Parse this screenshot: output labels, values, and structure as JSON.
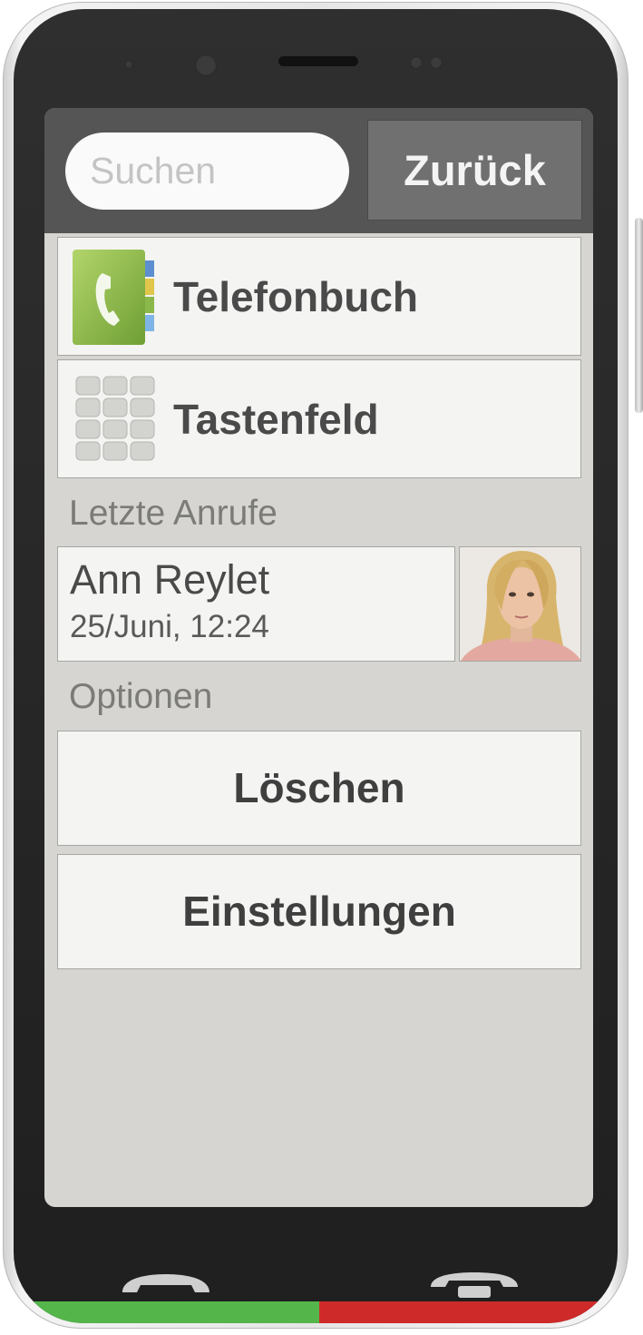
{
  "header": {
    "search_placeholder": "Suchen",
    "back_label": "Zurück"
  },
  "menu": {
    "phonebook_label": "Telefonbuch",
    "keypad_label": "Tastenfeld"
  },
  "recent_calls": {
    "section_title": "Letzte Anrufe",
    "items": [
      {
        "name": "Ann Reylet",
        "datetime": "25/Juni, 12:24"
      }
    ]
  },
  "options": {
    "section_title": "Optionen",
    "delete_label": "Löschen",
    "settings_label": "Einstellungen"
  },
  "colors": {
    "call_accept": "#54b64a",
    "call_end": "#cf2a2a",
    "phonebook_icon": "#8cc04b",
    "topbar": "#555555"
  },
  "icons": {
    "phonebook": "phonebook-icon",
    "keypad": "keypad-icon",
    "call_accept": "call-accept-icon",
    "call_end": "call-end-icon"
  }
}
